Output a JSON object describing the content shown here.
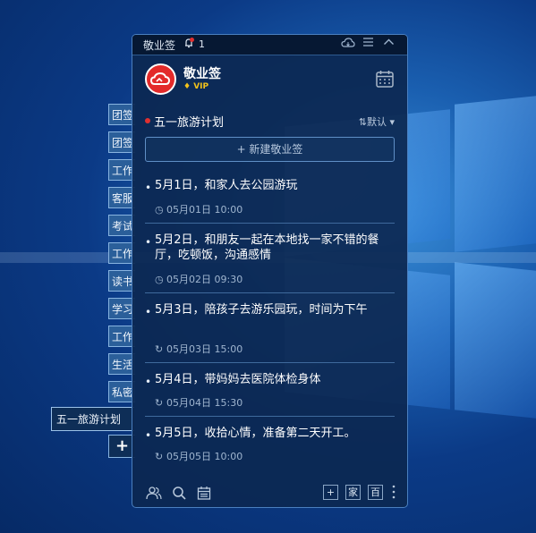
{
  "app": {
    "title": "敬业签",
    "notification_count": "1",
    "user_name": "敬业签",
    "vip_label": "VIP",
    "brand_color": "#e32a2a"
  },
  "side_tabs": [
    {
      "label": "团签"
    },
    {
      "label": "团签"
    },
    {
      "label": "工作"
    },
    {
      "label": "客服"
    },
    {
      "label": "考试"
    },
    {
      "label": "工作"
    },
    {
      "label": "读书"
    },
    {
      "label": "学习"
    },
    {
      "label": "工作"
    },
    {
      "label": "生活"
    },
    {
      "label": "私密"
    }
  ],
  "active_tab": {
    "label": "五一旅游计划"
  },
  "add_tab_label": "+",
  "list": {
    "title": "五一旅游计划",
    "sort_label": "默认",
    "new_note_label": "+ 新建敬业签"
  },
  "notes": [
    {
      "text": "5月1日，和家人去公园游玩",
      "time": "05月01日  10:00",
      "icon": "clock-icon"
    },
    {
      "text": "5月2日，和朋友一起在本地找一家不错的餐厅，吃顿饭，沟通感情",
      "time": "05月02日  09:30",
      "icon": "clock-icon"
    },
    {
      "text": "5月3日，陪孩子去游乐园玩，时间为下午",
      "time": "05月03日  15:00",
      "icon": "repeat-icon"
    },
    {
      "text": "5月4日，带妈妈去医院体检身体",
      "time": "05月04日  15:30",
      "icon": "repeat-icon"
    },
    {
      "text": "5月5日，收拾心情，准备第二天开工。",
      "time": "05月05日  10:00",
      "icon": "repeat-icon"
    }
  ],
  "bottom_bar": {
    "box_home": "家",
    "box_hundred": "百"
  }
}
